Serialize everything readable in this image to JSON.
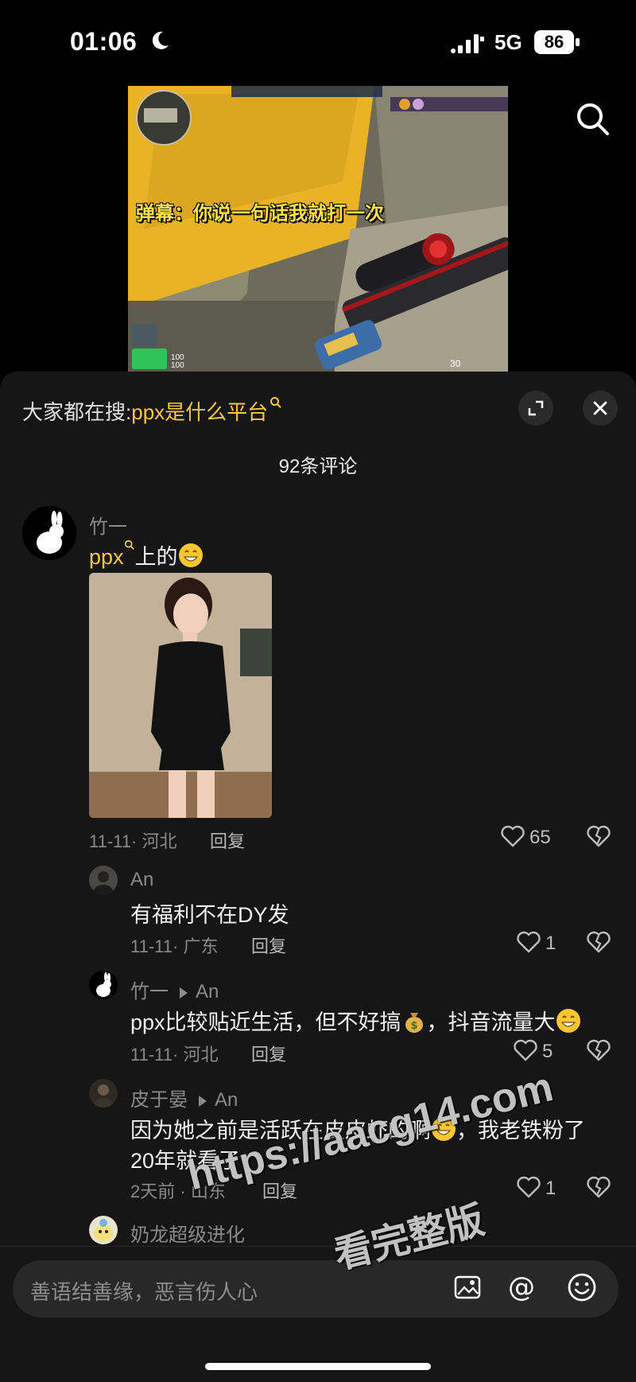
{
  "status_bar": {
    "time": "01:06",
    "network": "5G",
    "battery": "86"
  },
  "video": {
    "caption": "弹幕：你说一句话我就打一次",
    "hud_health": "100",
    "hud_armor": "100",
    "hud_ammo": "30"
  },
  "panel": {
    "hot_search_prefix": "大家都在搜:",
    "hot_search_keyword": "ppx是什么平台",
    "comment_count": "92条评论"
  },
  "comments": [
    {
      "user": "竹一",
      "text_link": "ppx",
      "text": "上的",
      "date": "11-11",
      "region": "河北",
      "reply_label": "回复",
      "likes": "65"
    }
  ],
  "replies": [
    {
      "user": "An",
      "text": "有福利不在DY发",
      "date": "11-11",
      "region": "广东",
      "reply_label": "回复",
      "likes": "1"
    },
    {
      "user": "竹一",
      "to": "An",
      "text_a": "ppx比较贴近生活，但不好搞",
      "text_b": "，抖音流量大",
      "date": "11-11",
      "region": "河北",
      "reply_label": "回复",
      "likes": "5"
    },
    {
      "user": "皮于晏",
      "to": "An",
      "text_a": "因为她之前是活跃在皮皮虾的啊",
      "text_b": "，我老铁粉了",
      "text_c": "20年就看了",
      "date": "2天前",
      "region": "山东",
      "reply_label": "回复",
      "likes": "1"
    },
    {
      "user": "奶龙超级进化"
    }
  ],
  "input": {
    "placeholder": "善语结善缘，恶言伤人心"
  },
  "watermark": {
    "line1": "https://aacg14.com",
    "line2": "看完整版"
  },
  "colors": {
    "panel_bg": "#161616",
    "keyword": "#ffc843",
    "meta": "#8a8a8a"
  }
}
